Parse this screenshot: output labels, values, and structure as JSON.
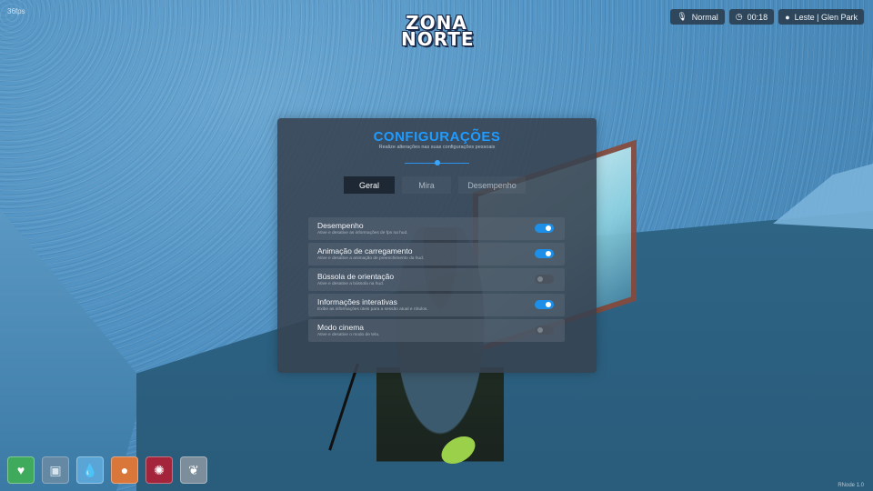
{
  "hud": {
    "fps": "36fps",
    "logo_line1": "ZONA",
    "logo_line2": "NORTE",
    "voice": "Normal",
    "time": "00:18",
    "location": "Leste | Glen Park",
    "version": "RNode 1.0"
  },
  "settings": {
    "title": "CONFIGURAÇÕES",
    "subtitle": "Realize alterações nas suas configurações pessoais",
    "tabs": [
      {
        "label": "Geral",
        "active": true
      },
      {
        "label": "Mira",
        "active": false
      },
      {
        "label": "Desempenho",
        "active": false
      }
    ],
    "options": [
      {
        "label": "Desempenho",
        "description": "Ative e desative as informações de fps na hud.",
        "enabled": true
      },
      {
        "label": "Animação de carregamento",
        "description": "Ative e desative a animação de preenchimento da hud.",
        "enabled": true
      },
      {
        "label": "Bússola de orientação",
        "description": "Ative e desative a bússola na hud.",
        "enabled": false
      },
      {
        "label": "Informações interativas",
        "description": "Exibe as informações úteis para a sessão atual e rótulos.",
        "enabled": true
      },
      {
        "label": "Modo cinema",
        "description": "Ative e desative o modo de tela.",
        "enabled": false
      }
    ]
  },
  "needs": [
    {
      "name": "health",
      "icon": "heart-icon",
      "color": "#3faa5c"
    },
    {
      "name": "armor",
      "icon": "vest-icon",
      "color": "#6f8ca3"
    },
    {
      "name": "thirst",
      "icon": "water-drop-icon",
      "color": "#5aa5d6"
    },
    {
      "name": "hunger",
      "icon": "apple-icon",
      "color": "#d9763a"
    },
    {
      "name": "stress",
      "icon": "brain-icon",
      "color": "#a3243b"
    },
    {
      "name": "oxygen",
      "icon": "lungs-icon",
      "color": "#7c8e9b"
    }
  ],
  "accent_color": "#1f9bff"
}
